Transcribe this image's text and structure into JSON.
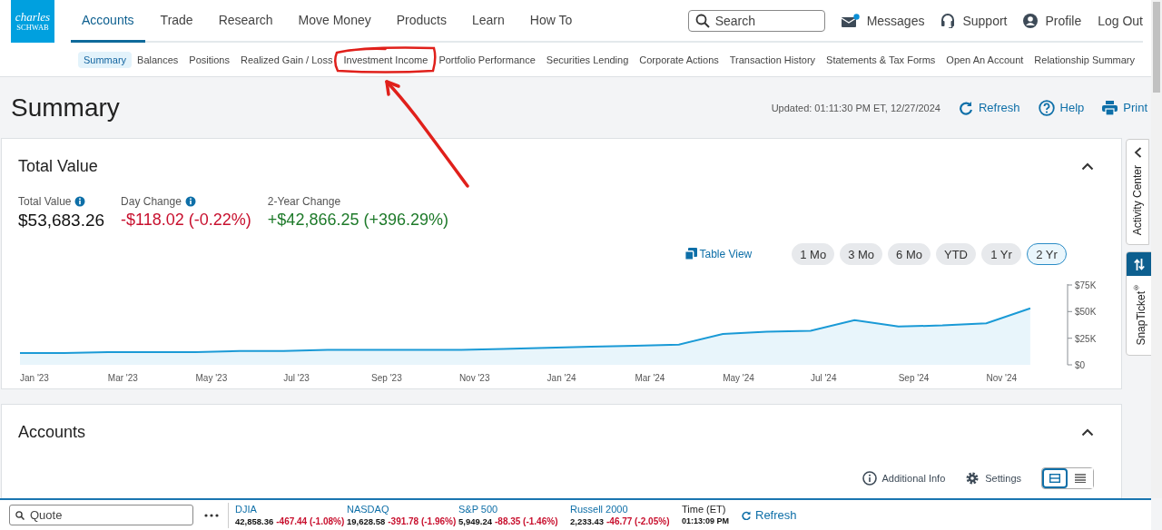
{
  "header": {
    "logo": {
      "line_1": "charles",
      "line_2": "SCHWAB"
    },
    "nav": [
      {
        "label": "Accounts",
        "selected": true
      },
      {
        "label": "Trade",
        "selected": false
      },
      {
        "label": "Research",
        "selected": false
      },
      {
        "label": "Move Money",
        "selected": false
      },
      {
        "label": "Products",
        "selected": false
      },
      {
        "label": "Learn",
        "selected": false
      },
      {
        "label": "How To",
        "selected": false
      }
    ],
    "search": {
      "placeholder": "Search"
    },
    "utilities": [
      {
        "kind": "messages",
        "label": "Messages",
        "unread": true
      },
      {
        "kind": "support",
        "label": "Support"
      },
      {
        "kind": "profile",
        "label": "Profile"
      },
      {
        "kind": "logout",
        "label": "Log Out"
      }
    ]
  },
  "subnav": [
    {
      "label": "Summary",
      "selected": true,
      "circled": false
    },
    {
      "label": "Balances",
      "selected": false,
      "circled": false
    },
    {
      "label": "Positions",
      "selected": false,
      "circled": false
    },
    {
      "label": "Realized Gain / Loss",
      "selected": false,
      "circled": false
    },
    {
      "label": "Investment Income",
      "selected": false,
      "circled": true
    },
    {
      "label": "Portfolio Performance",
      "selected": false,
      "circled": false
    },
    {
      "label": "Securities Lending",
      "selected": false,
      "circled": false
    },
    {
      "label": "Corporate Actions",
      "selected": false,
      "circled": false
    },
    {
      "label": "Transaction History",
      "selected": false,
      "circled": false
    },
    {
      "label": "Statements & Tax Forms",
      "selected": false,
      "circled": false
    },
    {
      "label": "Open An Account",
      "selected": false,
      "circled": false
    },
    {
      "label": "Relationship Summary",
      "selected": false,
      "circled": false
    }
  ],
  "annotation": {
    "kind": "circle-and-arrow",
    "color": "#e0201b"
  },
  "page": {
    "title": "Summary",
    "updated": "Updated: 01:11:30 PM ET, 12/27/2024",
    "actions": [
      {
        "kind": "refresh",
        "label": "Refresh"
      },
      {
        "kind": "help",
        "label": "Help"
      },
      {
        "kind": "print",
        "label": "Print"
      }
    ]
  },
  "total_value_card": {
    "title": "Total Value",
    "expanded": true,
    "metrics": [
      {
        "label": "Total Value",
        "info": true,
        "value": "$53,683.26",
        "color": "#111111"
      },
      {
        "label": "Day Change",
        "info": true,
        "value": "-$118.02 (-0.22%)",
        "color": "#c8102e"
      },
      {
        "label": "2-Year Change",
        "info": false,
        "value": "+$42,866.25 (+396.29%)",
        "color": "#1e7a2a"
      }
    ],
    "table_view": "Table View",
    "ranges": [
      {
        "label": "1 Mo",
        "selected": false
      },
      {
        "label": "3 Mo",
        "selected": false
      },
      {
        "label": "6 Mo",
        "selected": false
      },
      {
        "label": "YTD",
        "selected": false
      },
      {
        "label": "1 Yr",
        "selected": false
      },
      {
        "label": "2 Yr",
        "selected": true
      }
    ],
    "chart_data": {
      "type": "area",
      "categories": [
        "Jan '23",
        null,
        "Mar '23",
        null,
        "May '23",
        null,
        "Jul '23",
        null,
        "Sep '23",
        null,
        "Nov '23",
        null,
        "Jan '24",
        null,
        "Mar '24",
        null,
        "May '24",
        null,
        "Jul '24",
        null,
        "Sep '24",
        null,
        "Nov '24",
        null
      ],
      "series": [
        {
          "color": "#1a9ad6",
          "values": [
            11000,
            11000,
            12000,
            12000,
            12000,
            13000,
            13000,
            14000,
            14000,
            14000,
            14000,
            15000,
            16000,
            17000,
            18000,
            19000,
            29000,
            31000,
            32000,
            42000,
            36000,
            37000,
            39000,
            53000
          ]
        }
      ],
      "ylim": [
        0,
        75000
      ],
      "yticks": [
        {
          "value": 0,
          "label": "$0"
        },
        {
          "value": 25000,
          "label": "$25K"
        },
        {
          "value": 50000,
          "label": "$50K"
        },
        {
          "value": 75000,
          "label": "$75K"
        }
      ]
    }
  },
  "accounts_card": {
    "title": "Accounts",
    "expanded": true,
    "links": [
      {
        "kind": "info",
        "label": "Additional Info"
      },
      {
        "kind": "settings",
        "label": "Settings"
      }
    ],
    "view_toggle": [
      {
        "kind": "cards",
        "selected": true
      },
      {
        "kind": "list",
        "selected": false
      }
    ]
  },
  "side_tabs": [
    {
      "kind": "activity",
      "label": "Activity Center"
    },
    {
      "kind": "snapticket",
      "label": "SnapTicket$^{®}$"
    }
  ],
  "footer": {
    "quote": {
      "placeholder": "Quote"
    },
    "indices": [
      {
        "name": "DJIA",
        "value": "42,858.36",
        "change": "-467.44 (-1.08%)",
        "color": "#c8102e"
      },
      {
        "name": "NASDAQ",
        "value": "19,628.58",
        "change": "-391.78 (-1.96%)",
        "color": "#c8102e"
      },
      {
        "name": "S&P 500",
        "value": "5,949.24",
        "change": "-88.35 (-1.46%)",
        "color": "#c8102e"
      },
      {
        "name": "Russell 2000",
        "value": "2,233.43",
        "change": "-46.77 (-2.05%)",
        "color": "#c8102e"
      }
    ],
    "time": {
      "label": "Time (ET)",
      "value": "01:13:09 PM"
    },
    "refresh": "Refresh"
  }
}
